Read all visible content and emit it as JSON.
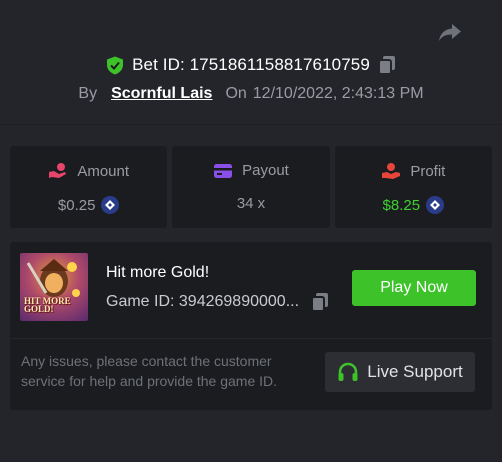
{
  "header": {
    "share_icon": "share-arrow-icon",
    "bet_label": "Bet ID: 1751861158817610759",
    "copy_icon": "copy-icon",
    "shield_icon": "shield-check-icon",
    "shield_color": "#3dc22a",
    "by_label": "By",
    "username": "Scornful Lais",
    "on_label": "On",
    "timestamp": "12/10/2022, 2:43:13 PM"
  },
  "stats": {
    "amount": {
      "label": "Amount",
      "value": "$0.25",
      "icon": "hand-coin-icon",
      "icon_color": "#e8456b",
      "currency_icon": "coin-icon"
    },
    "payout": {
      "label": "Payout",
      "value": "34 x",
      "icon": "card-icon",
      "icon_color": "#8a4fe8"
    },
    "profit": {
      "label": "Profit",
      "value": "$8.25",
      "icon": "profit-hand-icon",
      "icon_color": "#e8453a",
      "value_color": "#3dd22f",
      "currency_icon": "coin-icon"
    }
  },
  "game": {
    "thumbnail_text": "HIT MORE GOLD!",
    "title": "Hit more Gold!",
    "id_label": "Game ID: 394269890000...",
    "copy_icon": "copy-icon",
    "play_label": "Play Now",
    "play_color": "#3dc22a",
    "help_text": "Any issues, please contact the customer service for help and provide the game ID.",
    "support_label": "Live Support",
    "support_icon": "headset-icon",
    "support_icon_color": "#3dc22a"
  }
}
